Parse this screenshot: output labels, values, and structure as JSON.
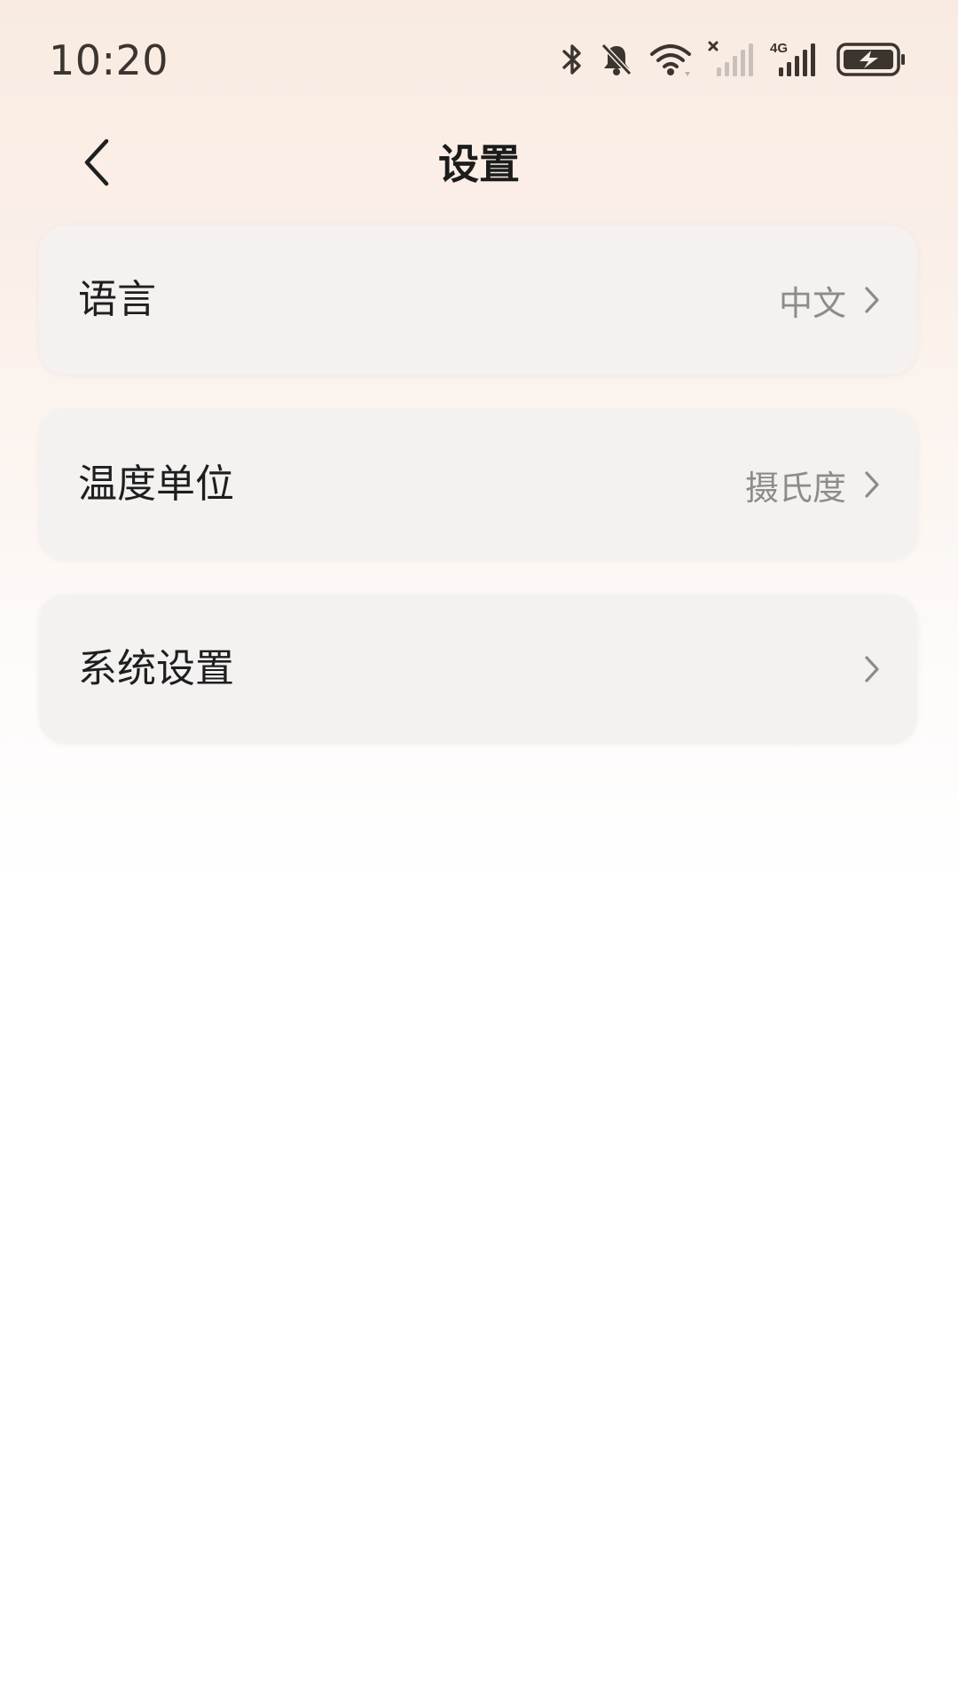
{
  "status_bar": {
    "time": "10:20",
    "icons": [
      "bluetooth-icon",
      "bell-muted-icon",
      "wifi-icon",
      "signal-no-sim-icon",
      "signal-4g-icon",
      "battery-charging-icon"
    ],
    "network_label": "4G"
  },
  "header": {
    "title": "设置",
    "back_icon": "chevron-left-icon"
  },
  "settings": {
    "items": [
      {
        "label": "语言",
        "value": "中文"
      },
      {
        "label": "温度单位",
        "value": "摄氏度"
      },
      {
        "label": "系统设置",
        "value": ""
      }
    ]
  },
  "colors": {
    "background_top": "#f9ebe1",
    "background_bottom": "#ffffff",
    "card": "#f3f1f0",
    "value_text": "#8e8b89",
    "title_text": "#1c1c1c"
  }
}
